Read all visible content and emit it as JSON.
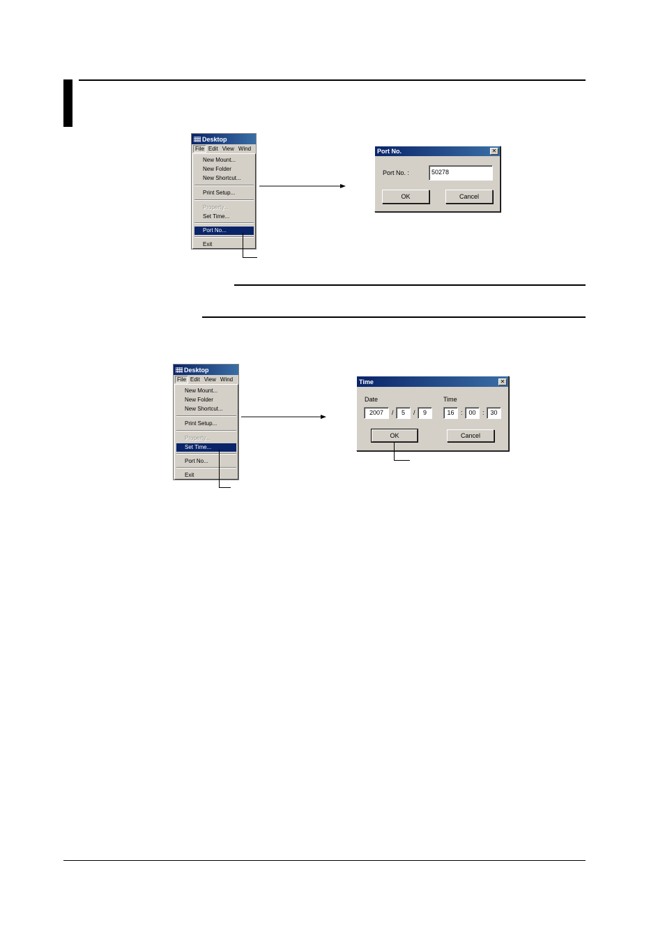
{
  "menu_window": {
    "title": "Desktop",
    "menubar": [
      "File",
      "Edit",
      "View",
      "Wind"
    ],
    "items": [
      {
        "label": "New Mount...",
        "disabled": false
      },
      {
        "label": "New Folder",
        "disabled": false
      },
      {
        "label": "New Shortcut...",
        "disabled": false
      },
      {
        "label": "Print Setup...",
        "disabled": false
      },
      {
        "label": "Property...",
        "disabled": true
      },
      {
        "label": "Set Time...",
        "disabled": false
      },
      {
        "label": "Port No...",
        "disabled": false
      },
      {
        "label": "Exit",
        "disabled": false
      }
    ]
  },
  "port_dialog": {
    "title": "Port No.",
    "field_label": "Port No. :",
    "field_value": "50278",
    "ok_label": "OK",
    "cancel_label": "Cancel"
  },
  "time_dialog": {
    "title": "Time",
    "date_label": "Date",
    "time_label": "Time",
    "year": "2007",
    "month": "5",
    "day": "9",
    "hour": "16",
    "minute": "00",
    "second": "30",
    "date_sep": "/",
    "time_sep": ":",
    "ok_label": "OK",
    "cancel_label": "Cancel"
  },
  "close_glyph": "✕",
  "colors": {
    "title_bar": "#0a246a",
    "highlight": "#0a246a",
    "face": "#d4d0c8"
  }
}
